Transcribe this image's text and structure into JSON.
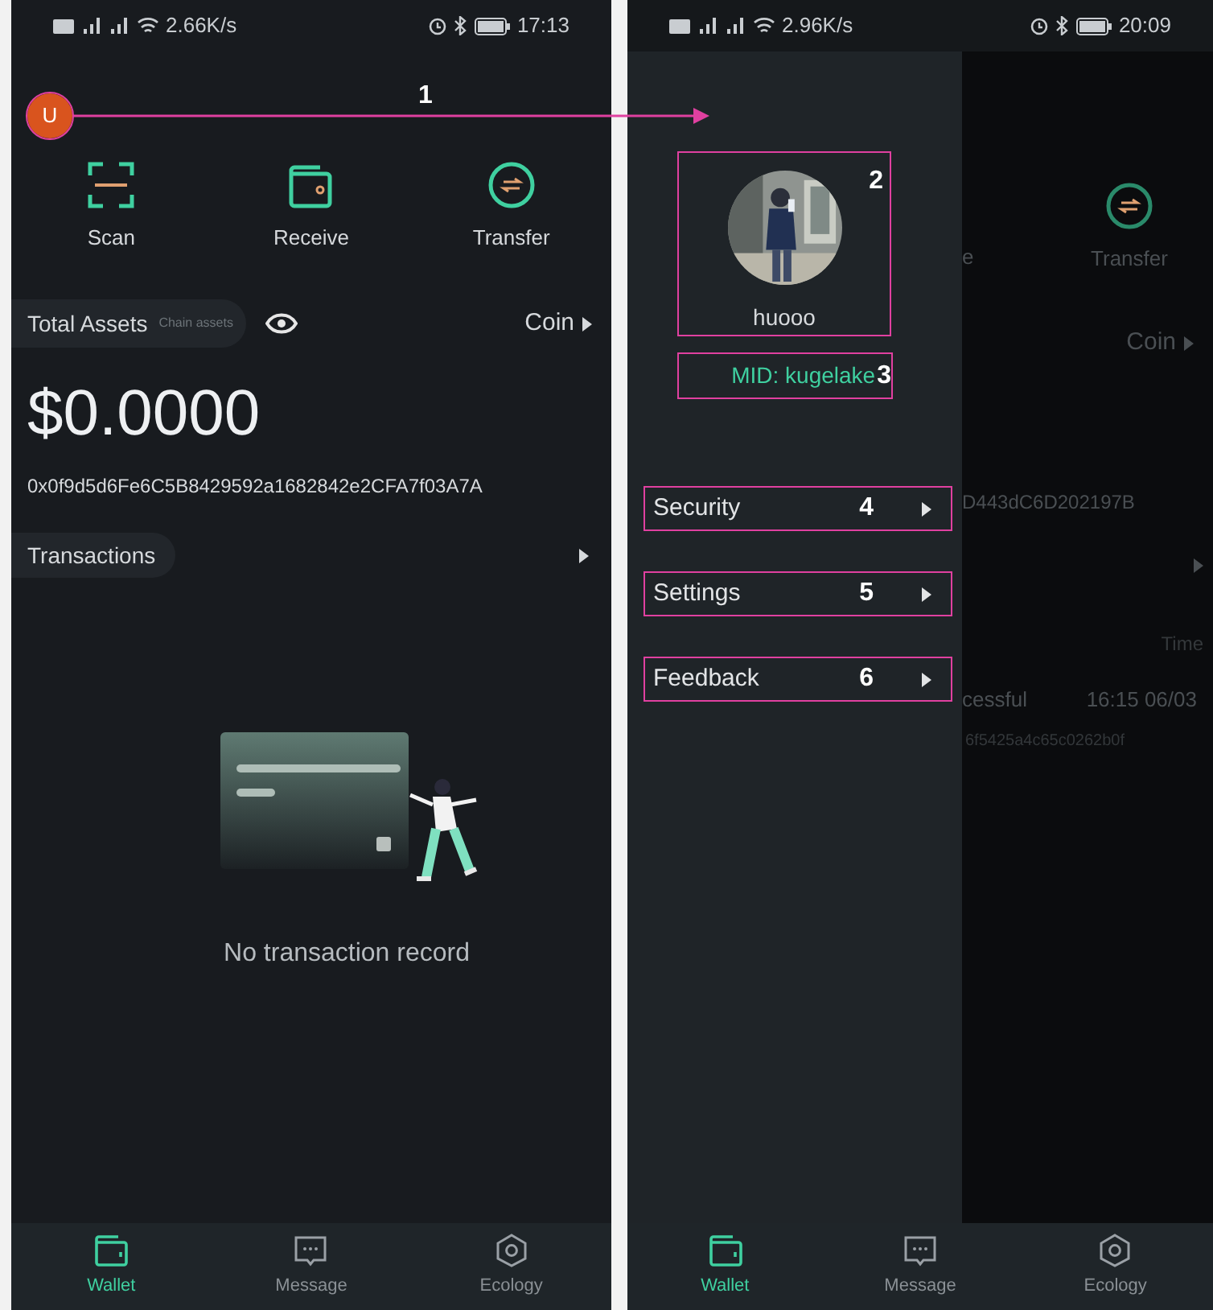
{
  "left_screen": {
    "status_bar": {
      "speed": "2.66K/s",
      "time": "17:13"
    },
    "avatar": {
      "letter": "U",
      "annotation": "1"
    },
    "actions": [
      {
        "kind": "scan",
        "label": "Scan"
      },
      {
        "kind": "receive",
        "label": "Receive"
      },
      {
        "kind": "transfer",
        "label": "Transfer"
      }
    ],
    "assets": {
      "title": "Total Assets",
      "subtitle": "Chain assets",
      "unit": "Coin",
      "balance": "$0.0000",
      "address": "0x0f9d5d6Fe6C5B8429592a1682842e2CFA7f03A7A"
    },
    "transactions": {
      "title": "Transactions",
      "empty_text": "No transaction record"
    },
    "nav": [
      {
        "kind": "wallet",
        "label": "Wallet",
        "selected": true
      },
      {
        "kind": "message",
        "label": "Message",
        "selected": false
      },
      {
        "kind": "ecology",
        "label": "Ecology",
        "selected": false
      }
    ]
  },
  "right_screen": {
    "status_bar": {
      "speed": "2.96K/s",
      "time": "20:09"
    },
    "background": {
      "receive_tail": "e",
      "transfer": "Transfer",
      "coin": "Coin",
      "address_tail": "D443dC6D202197B",
      "time_header": "Time",
      "status_tail": "cessful",
      "datetime": "16:15 06/03",
      "hash_tail": "6f5425a4c65c0262b0f"
    },
    "drawer": {
      "profile": {
        "name": "huooo",
        "annotation": "2"
      },
      "mid": {
        "text": "MID: kugelake",
        "annotation": "3"
      },
      "menu": [
        {
          "label": "Security",
          "annotation": "4"
        },
        {
          "label": "Settings",
          "annotation": "5"
        },
        {
          "label": "Feedback",
          "annotation": "6"
        }
      ]
    },
    "nav": [
      {
        "kind": "wallet",
        "label": "Wallet",
        "selected": true
      },
      {
        "kind": "message",
        "label": "Message",
        "selected": false
      },
      {
        "kind": "ecology",
        "label": "Ecology",
        "selected": false
      }
    ]
  }
}
